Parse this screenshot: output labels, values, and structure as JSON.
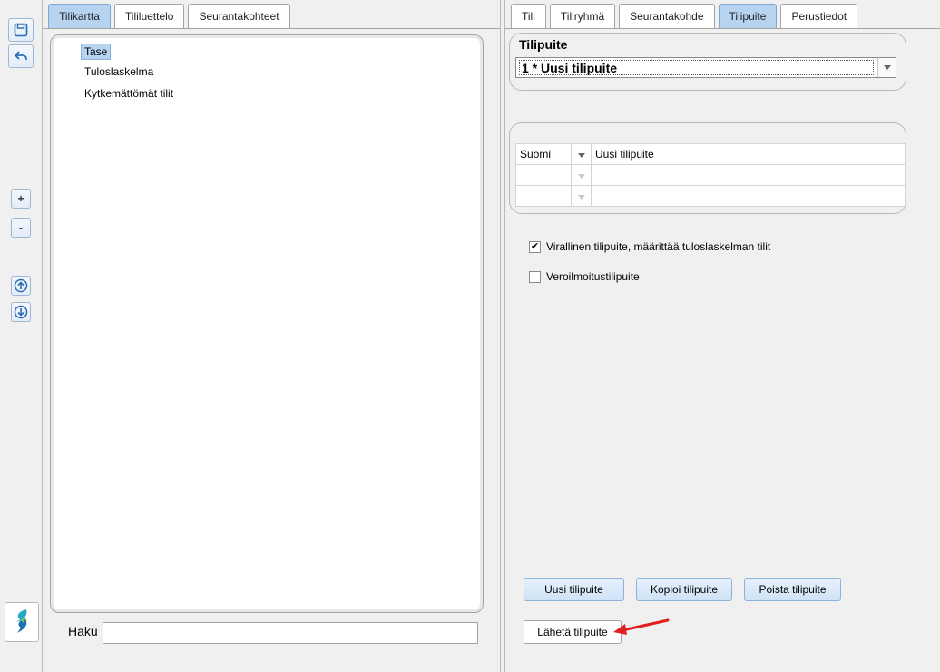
{
  "left_panel": {
    "tabs": [
      {
        "label": "Tilikartta",
        "active": true
      },
      {
        "label": "Tililuettelo",
        "active": false
      },
      {
        "label": "Seurantakohteet",
        "active": false
      }
    ],
    "tree": [
      {
        "label": "Tase",
        "selected": true
      },
      {
        "label": "Tuloslaskelma",
        "selected": false
      },
      {
        "label": "Kytkemättömät tilit",
        "selected": false
      }
    ],
    "search": {
      "label": "Haku",
      "value": ""
    }
  },
  "toolbar": {
    "icons": [
      "save-icon",
      "undo-icon",
      "expand-plus",
      "collapse-minus",
      "move-up-icon",
      "move-down-icon",
      "app-logo"
    ],
    "plus_label": "+",
    "minus_label": "-"
  },
  "right_panel": {
    "tabs": [
      {
        "label": "Tili",
        "active": false
      },
      {
        "label": "Tiliryhmä",
        "active": false
      },
      {
        "label": "Seurantakohde",
        "active": false
      },
      {
        "label": "Tilipuite",
        "active": true
      },
      {
        "label": "Perustiedot",
        "active": false
      }
    ],
    "selector": {
      "title": "Tilipuite",
      "selected_value": "1 * Uusi tilipuite"
    },
    "names_table": [
      {
        "language": "Suomi",
        "name": "Uusi tilipuite"
      },
      {
        "language": "",
        "name": ""
      },
      {
        "language": "",
        "name": ""
      }
    ],
    "checkboxes": [
      {
        "label": "Virallinen tilipuite, määrittää tuloslaskelman tilit",
        "checked": true
      },
      {
        "label": "Veroilmoitustilipuite",
        "checked": false
      }
    ],
    "buttons": {
      "new": "Uusi tilipuite",
      "copy": "Kopioi tilipuite",
      "delete": "Poista tilipuite",
      "send": "Lähetä tilipuite"
    }
  },
  "colors": {
    "active_tab": "#b6d3f0",
    "button_blue": "#cfe2f6",
    "annotation_arrow": "#e02020"
  }
}
